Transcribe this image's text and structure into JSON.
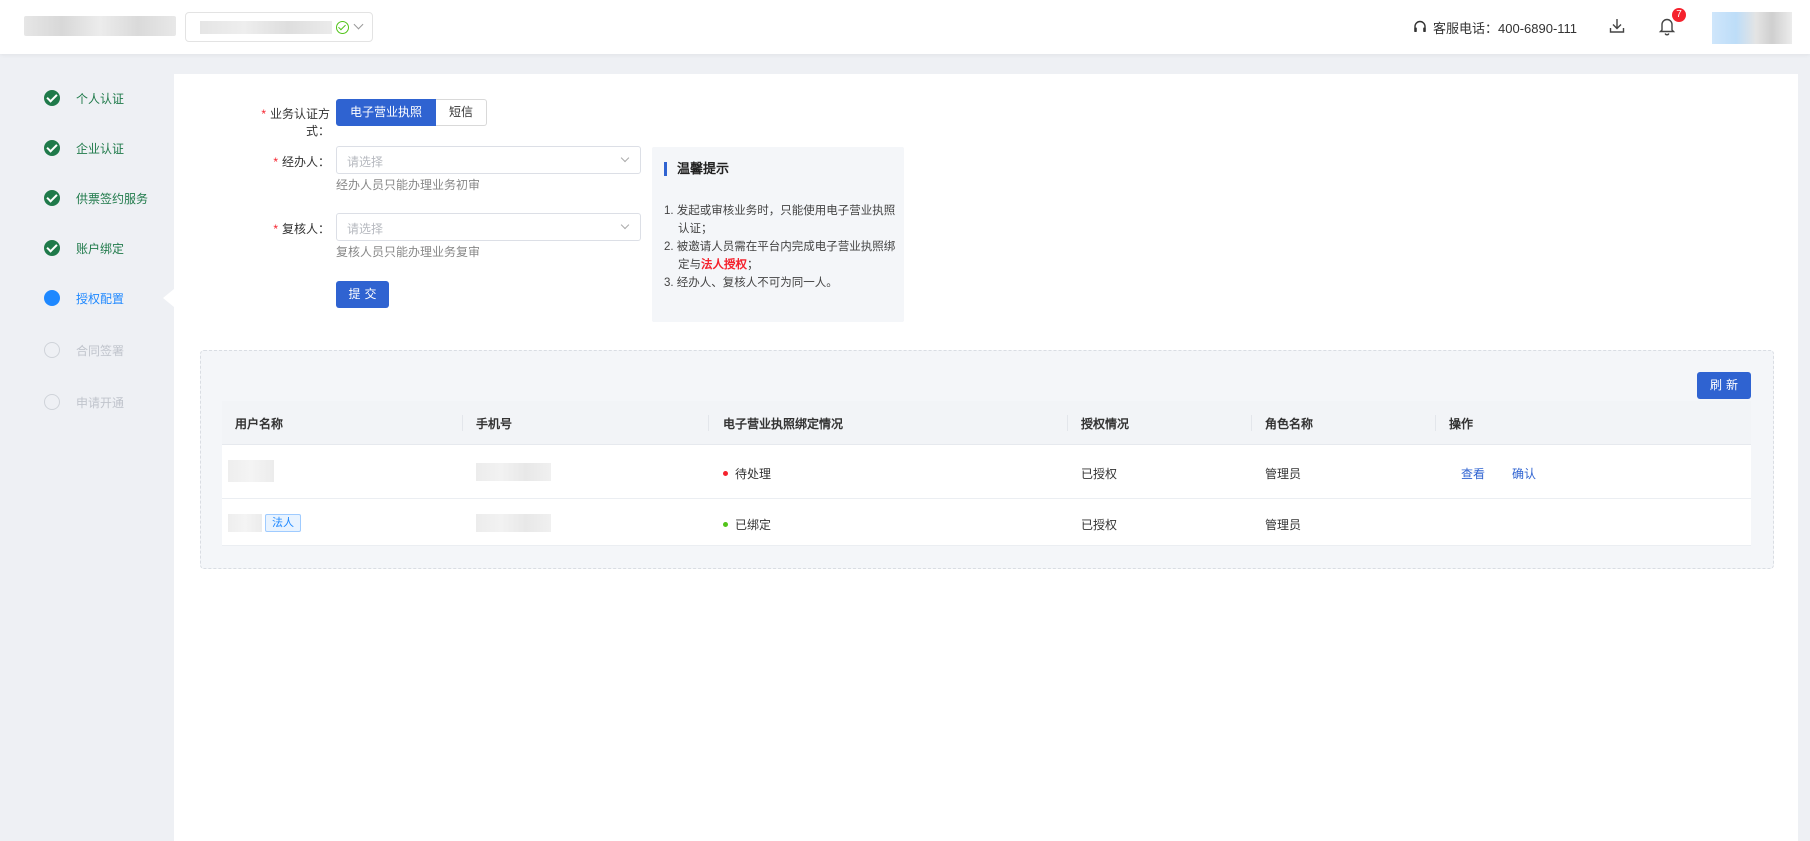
{
  "header": {
    "service_phone": "客服电话：400-6890-111",
    "notification_count": "7"
  },
  "steps": [
    {
      "label": "个人认证",
      "status": "done"
    },
    {
      "label": "企业认证",
      "status": "done"
    },
    {
      "label": "供票签约服务",
      "status": "done"
    },
    {
      "label": "账户绑定",
      "status": "done"
    },
    {
      "label": "授权配置",
      "status": "active"
    },
    {
      "label": "合同签署",
      "status": "todo"
    },
    {
      "label": "申请开通",
      "status": "todo"
    }
  ],
  "form": {
    "auth_method_label": "业务认证方式：",
    "auth_options": [
      "电子营业执照",
      "短信"
    ],
    "handler_label": "经办人：",
    "handler_placeholder": "请选择",
    "handler_hint": "经办人员只能办理业务初审",
    "reviewer_label": "复核人：",
    "reviewer_placeholder": "请选择",
    "reviewer_hint": "复核人员只能办理业务复审",
    "submit_label": "提交"
  },
  "tips": {
    "title": "温馨提示",
    "item1": "1. 发起或审核业务时，只能使用电子营业执照认证；",
    "item2_prefix": "2. 被邀请人员需在平台内完成电子营业执照绑定与",
    "item2_highlight": "法人授权",
    "item2_suffix": "；",
    "item3": "3. 经办人、复核人不可为同一人。"
  },
  "table": {
    "refresh_label": "刷新",
    "columns": [
      "用户名称",
      "手机号",
      "电子营业执照绑定情况",
      "授权情况",
      "角色名称",
      "操作"
    ],
    "rows": [
      {
        "bind_status": "待处理",
        "auth_status": "已授权",
        "role": "管理员",
        "actions": [
          "查看",
          "确认"
        ],
        "tag": ""
      },
      {
        "bind_status": "已绑定",
        "auth_status": "已授权",
        "role": "管理员",
        "actions": [],
        "tag": "法人"
      }
    ]
  },
  "colors": {
    "primary": "#2f63d1",
    "step_done": "#1f7a4a",
    "step_active": "#1e88ff",
    "danger": "#f5222d",
    "success": "#52c41a"
  }
}
